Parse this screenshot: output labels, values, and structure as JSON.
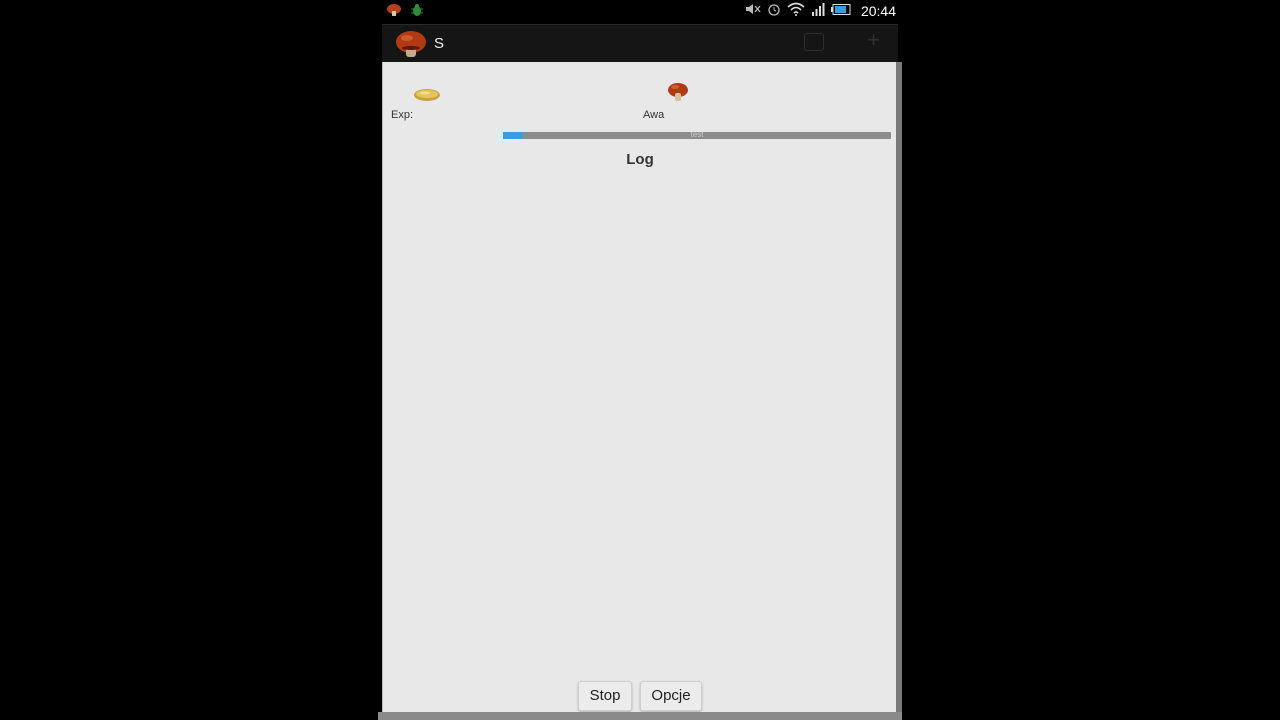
{
  "status_bar": {
    "time": "20:44",
    "left_icons": [
      "mushroom-notification-icon",
      "bug-notification-icon"
    ],
    "right_icons": [
      "mute-icon",
      "alarm-icon",
      "wifi-icon",
      "signal-icon",
      "battery-icon"
    ],
    "battery_level": 0.85
  },
  "action_bar": {
    "title": "S",
    "app_icon": "mushroom-icon"
  },
  "stats": {
    "exp_label": "Exp:",
    "awa_label": "Awa",
    "coin_icon": "coin-icon",
    "mushroom_icon": "mushroom-icon"
  },
  "progress": {
    "label": "test",
    "value": 0.05,
    "fill_color": "#3a9be0"
  },
  "log": {
    "title": "Log"
  },
  "buttons": {
    "stop": "Stop",
    "options": "Opcje"
  },
  "colors": {
    "content_bg": "#e8e8e8",
    "action_bar_bg": "#151515"
  }
}
